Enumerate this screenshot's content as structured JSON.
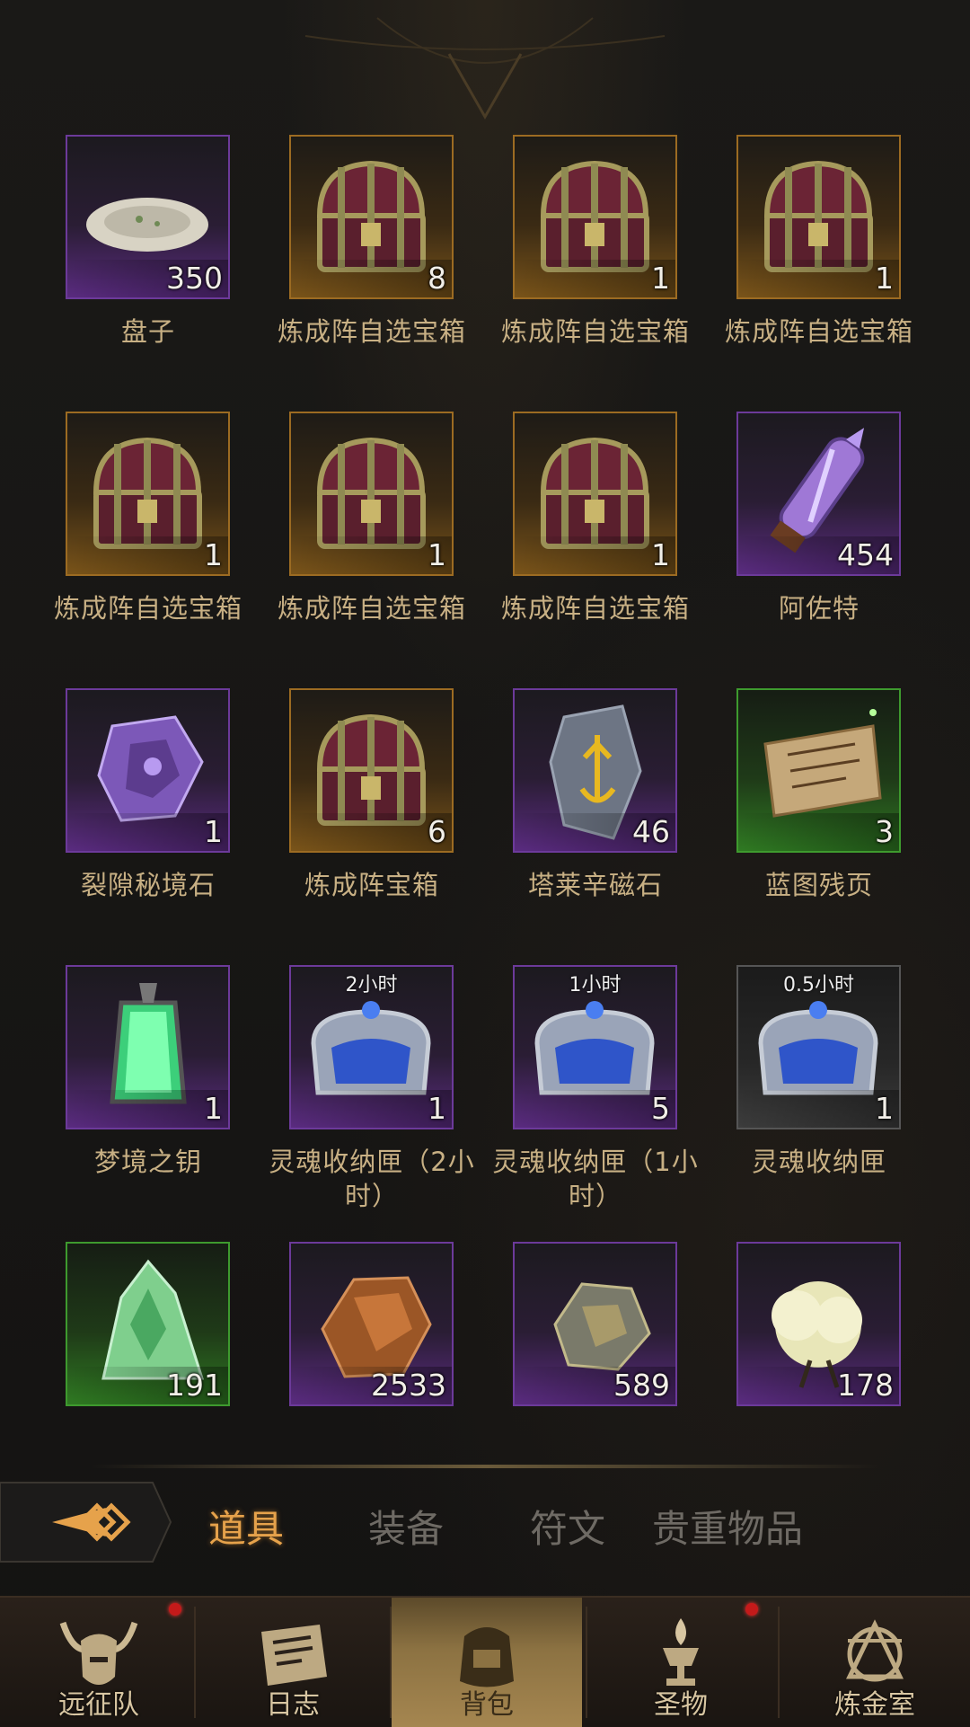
{
  "items": [
    {
      "name": "盘子",
      "count": "350",
      "rarity": "purple",
      "icon": "plate-icon",
      "timer": ""
    },
    {
      "name": "炼成阵自选宝箱",
      "count": "8",
      "rarity": "orange",
      "icon": "treasure-chest-icon",
      "timer": ""
    },
    {
      "name": "炼成阵自选宝箱",
      "count": "1",
      "rarity": "orange",
      "icon": "treasure-chest-icon",
      "timer": ""
    },
    {
      "name": "炼成阵自选宝箱",
      "count": "1",
      "rarity": "orange",
      "icon": "treasure-chest-icon",
      "timer": ""
    },
    {
      "name": "炼成阵自选宝箱",
      "count": "1",
      "rarity": "orange",
      "icon": "treasure-chest-icon",
      "timer": ""
    },
    {
      "name": "炼成阵自选宝箱",
      "count": "1",
      "rarity": "orange",
      "icon": "treasure-chest-icon",
      "timer": ""
    },
    {
      "name": "炼成阵自选宝箱",
      "count": "1",
      "rarity": "orange",
      "icon": "treasure-chest-icon",
      "timer": ""
    },
    {
      "name": "阿佐特",
      "count": "454",
      "rarity": "purple",
      "icon": "crystal-vial-icon",
      "timer": ""
    },
    {
      "name": "裂隙秘境石",
      "count": "1",
      "rarity": "purple",
      "icon": "rift-stone-icon",
      "timer": ""
    },
    {
      "name": "炼成阵宝箱",
      "count": "6",
      "rarity": "orange",
      "icon": "treasure-chest-icon",
      "timer": ""
    },
    {
      "name": "塔莱辛磁石",
      "count": "46",
      "rarity": "purple",
      "icon": "rune-stone-icon",
      "timer": ""
    },
    {
      "name": "蓝图残页",
      "count": "3",
      "rarity": "green",
      "icon": "scroll-icon",
      "timer": ""
    },
    {
      "name": "梦境之钥",
      "count": "1",
      "rarity": "purple",
      "icon": "green-lantern-icon",
      "timer": ""
    },
    {
      "name": "灵魂收纳匣（2小时）",
      "count": "1",
      "rarity": "purple",
      "icon": "soul-casket-icon",
      "timer": "2小时"
    },
    {
      "name": "灵魂收纳匣（1小时）",
      "count": "5",
      "rarity": "purple",
      "icon": "soul-casket-icon",
      "timer": "1小时"
    },
    {
      "name": "灵魂收纳匣",
      "count": "1",
      "rarity": "gray",
      "icon": "soul-casket-icon",
      "timer": "0.5小时"
    },
    {
      "name": "",
      "count": "191",
      "rarity": "green",
      "icon": "green-ore-icon",
      "timer": ""
    },
    {
      "name": "",
      "count": "2533",
      "rarity": "purple",
      "icon": "amber-ore-icon",
      "timer": ""
    },
    {
      "name": "",
      "count": "589",
      "rarity": "purple",
      "icon": "smoky-ore-icon",
      "timer": ""
    },
    {
      "name": "",
      "count": "178",
      "rarity": "purple",
      "icon": "cotton-icon",
      "timer": ""
    }
  ],
  "tabs": [
    {
      "label": "道具",
      "active": true
    },
    {
      "label": "装备",
      "active": false
    },
    {
      "label": "符文",
      "active": false
    },
    {
      "label": "贵重物品",
      "active": false
    }
  ],
  "nav": [
    {
      "label": "远征队",
      "icon": "horned-helmet-icon",
      "badge": true,
      "active": false
    },
    {
      "label": "日志",
      "icon": "journal-scroll-icon",
      "badge": false,
      "active": false
    },
    {
      "label": "背包",
      "icon": "backpack-icon",
      "badge": false,
      "active": true
    },
    {
      "label": "圣物",
      "icon": "chalice-flame-icon",
      "badge": true,
      "active": false
    },
    {
      "label": "炼金室",
      "icon": "alchemy-symbol-icon",
      "badge": false,
      "active": false
    }
  ],
  "colors": {
    "accent": "#e6a24b",
    "purple": "#6c3a9a",
    "orange": "#9c6b22",
    "green": "#3e9a2e",
    "badge": "#c41a1a"
  }
}
